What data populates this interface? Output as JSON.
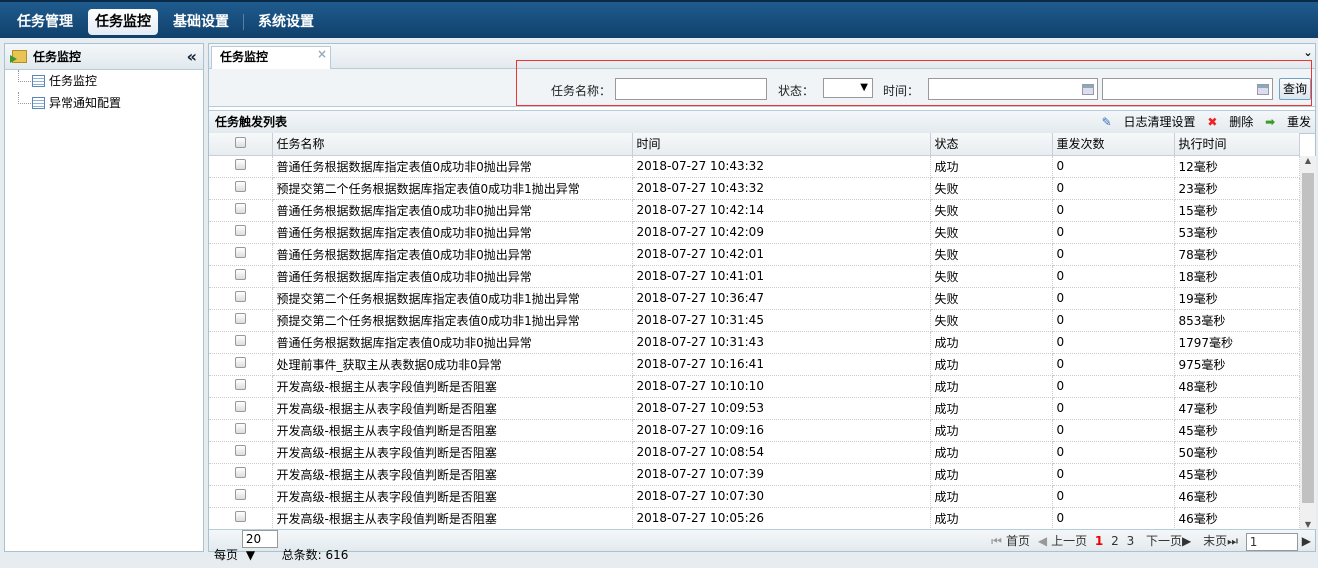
{
  "nav": [
    "任务管理",
    "任务监控",
    "基础设置",
    "系统设置"
  ],
  "sidebar": {
    "title": "任务监控",
    "collapse": "«",
    "items": [
      "任务监控",
      "异常通知配置"
    ]
  },
  "tab": {
    "label": "任务监控",
    "close": "×",
    "menu": "¥"
  },
  "search": {
    "name_label": "任务名称：",
    "status_label": "状态：",
    "status_arrow": "▼",
    "time_label": "时间：",
    "query": "查询"
  },
  "list": {
    "title": "任务触发列表",
    "actions": [
      "日志清理设置",
      "删除",
      "重发"
    ]
  },
  "columns": [
    "任务名称",
    "时间",
    "状态",
    "重发次数",
    "执行时间"
  ],
  "rows": [
    [
      "普通任务根据数据库指定表值0成功非0抛出异常",
      "2018-07-27 10:43:32",
      "成功",
      "0",
      "12毫秒"
    ],
    [
      "预提交第二个任务根据数据库指定表值0成功非1抛出异常",
      "2018-07-27 10:43:32",
      "失败",
      "0",
      "23毫秒"
    ],
    [
      "普通任务根据数据库指定表值0成功非0抛出异常",
      "2018-07-27 10:42:14",
      "失败",
      "0",
      "15毫秒"
    ],
    [
      "普通任务根据数据库指定表值0成功非0抛出异常",
      "2018-07-27 10:42:09",
      "失败",
      "0",
      "53毫秒"
    ],
    [
      "普通任务根据数据库指定表值0成功非0抛出异常",
      "2018-07-27 10:42:01",
      "失败",
      "0",
      "78毫秒"
    ],
    [
      "普通任务根据数据库指定表值0成功非0抛出异常",
      "2018-07-27 10:41:01",
      "失败",
      "0",
      "18毫秒"
    ],
    [
      "预提交第二个任务根据数据库指定表值0成功非1抛出异常",
      "2018-07-27 10:36:47",
      "失败",
      "0",
      "19毫秒"
    ],
    [
      "预提交第二个任务根据数据库指定表值0成功非1抛出异常",
      "2018-07-27 10:31:45",
      "失败",
      "0",
      "853毫秒"
    ],
    [
      "普通任务根据数据库指定表值0成功非0抛出异常",
      "2018-07-27 10:31:43",
      "成功",
      "0",
      "1797毫秒"
    ],
    [
      "处理前事件_获取主从表数据0成功非0异常",
      "2018-07-27 10:16:41",
      "成功",
      "0",
      "975毫秒"
    ],
    [
      "开发高级-根据主从表字段值判断是否阻塞",
      "2018-07-27 10:10:10",
      "成功",
      "0",
      "48毫秒"
    ],
    [
      "开发高级-根据主从表字段值判断是否阻塞",
      "2018-07-27 10:09:53",
      "成功",
      "0",
      "47毫秒"
    ],
    [
      "开发高级-根据主从表字段值判断是否阻塞",
      "2018-07-27 10:09:16",
      "成功",
      "0",
      "45毫秒"
    ],
    [
      "开发高级-根据主从表字段值判断是否阻塞",
      "2018-07-27 10:08:54",
      "成功",
      "0",
      "50毫秒"
    ],
    [
      "开发高级-根据主从表字段值判断是否阻塞",
      "2018-07-27 10:07:39",
      "成功",
      "0",
      "45毫秒"
    ],
    [
      "开发高级-根据主从表字段值判断是否阻塞",
      "2018-07-27 10:07:30",
      "成功",
      "0",
      "46毫秒"
    ],
    [
      "开发高级-根据主从表字段值判断是否阻塞",
      "2018-07-27 10:05:26",
      "成功",
      "0",
      "46毫秒"
    ]
  ],
  "pager": {
    "per_page_label": "每页",
    "per_page": "20 ▼",
    "total": "总条数: 616",
    "first": "首页",
    "prev": "上一页",
    "pages": [
      "1",
      "2",
      "3"
    ],
    "next": "下一页",
    "last": "末页",
    "page_input": "1"
  }
}
